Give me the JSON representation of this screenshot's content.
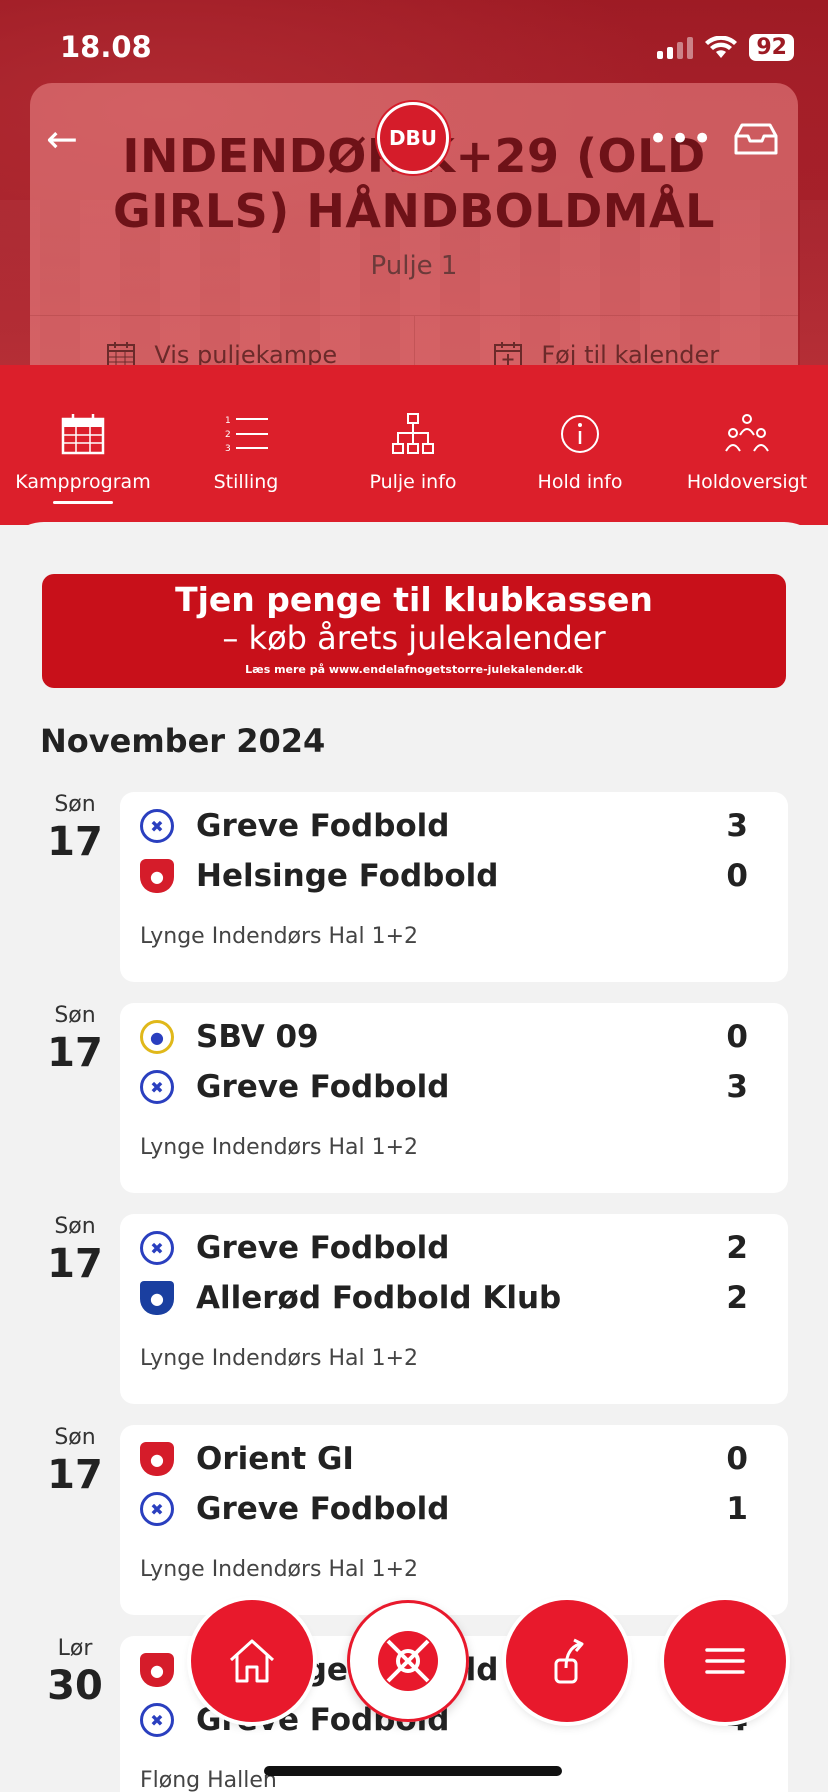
{
  "status": {
    "time": "18.08",
    "battery": "92"
  },
  "header": {
    "title_line1": "INDENDØR K+29 (OLD",
    "title_line2": "GIRLS) HÅNDBOLDMÅL",
    "subtitle": "Pulje 1",
    "logo_text": "DBU",
    "actions": [
      {
        "label": "Vis puljekampe",
        "icon": "calendar-grid-icon"
      },
      {
        "label": "Føj til kalender",
        "icon": "calendar-add-icon"
      }
    ]
  },
  "tabs": [
    {
      "label": "Kampprogram",
      "icon": "calendar-icon",
      "active": true
    },
    {
      "label": "Stilling",
      "icon": "ordered-list-icon",
      "active": false
    },
    {
      "label": "Pulje info",
      "icon": "hierarchy-icon",
      "active": false
    },
    {
      "label": "Hold info",
      "icon": "info-icon",
      "active": false
    },
    {
      "label": "Holdoversigt",
      "icon": "people-icon",
      "active": false
    }
  ],
  "banner": {
    "line1": "Tjen penge til klubkassen",
    "line2": "– køb årets julekalender",
    "line3": "Læs mere på www.endelafnogetstorre-julekalender.dk"
  },
  "month": "November 2024",
  "matches": [
    {
      "dow": "Søn",
      "day": "17",
      "home": "Greve Fodbold",
      "home_score": "3",
      "away": "Helsinge Fodbold",
      "away_score": "0",
      "venue": "Lynge Indendørs Hal 1+2"
    },
    {
      "dow": "Søn",
      "day": "17",
      "home": "SBV 09",
      "home_score": "0",
      "away": "Greve Fodbold",
      "away_score": "3",
      "venue": "Lynge Indendørs Hal 1+2"
    },
    {
      "dow": "Søn",
      "day": "17",
      "home": "Greve Fodbold",
      "home_score": "2",
      "away": "Allerød Fodbold Klub",
      "away_score": "2",
      "venue": "Lynge Indendørs Hal 1+2"
    },
    {
      "dow": "Søn",
      "day": "17",
      "home": "Orient GI",
      "home_score": "0",
      "away": "Greve Fodbold",
      "away_score": "1",
      "venue": "Lynge Indendørs Hal 1+2"
    },
    {
      "dow": "Lør",
      "day": "30",
      "home": "Helsinge Fodbold",
      "home_score": "",
      "away": "Greve Fodbold",
      "away_score": "4",
      "venue": "Fløng Hallen"
    }
  ],
  "fabs": [
    "home-icon",
    "ball-icon",
    "share-icon",
    "menu-icon"
  ]
}
